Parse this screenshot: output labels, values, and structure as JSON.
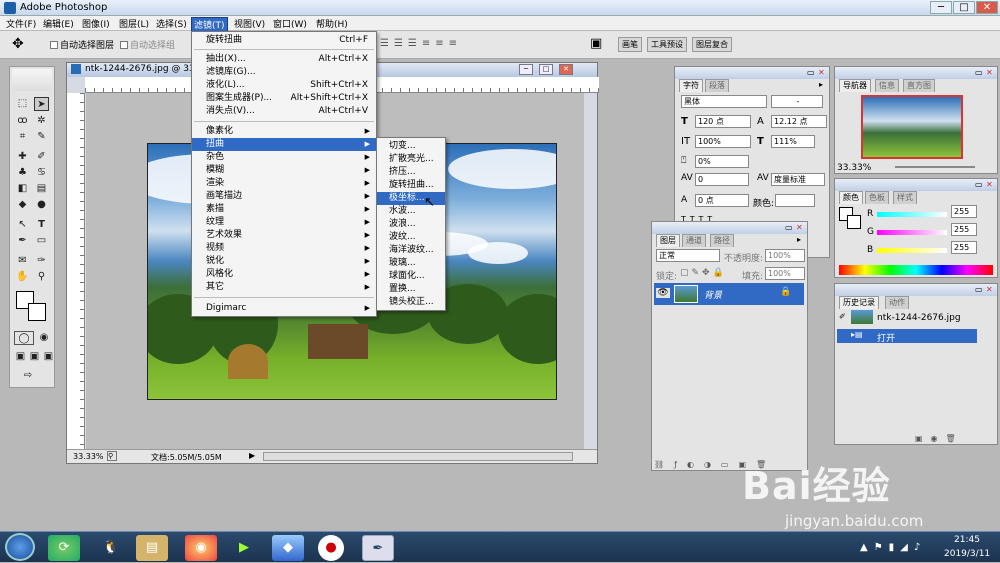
{
  "app": {
    "title": "Adobe Photoshop"
  },
  "menubar": [
    "文件(F)",
    "编辑(E)",
    "图像(I)",
    "图层(L)",
    "选择(S)",
    "滤镜(T)",
    "视图(V)",
    "窗口(W)",
    "帮助(H)"
  ],
  "options": {
    "auto_select_layer": "自动选择图层",
    "auto_select_group": "自动选择组",
    "dock_tabs": [
      "画笔",
      "工具预设",
      "图层复合"
    ]
  },
  "document": {
    "title": "ntk-1244-2676.jpg @ 33",
    "zoom": "33.33%",
    "doc_info": "文档:5.05M/5.05M"
  },
  "filter_menu": {
    "items": [
      {
        "label": "旋转扭曲",
        "shortcut": "Ctrl+F"
      },
      {
        "label": "抽出(X)...",
        "shortcut": "Alt+Ctrl+X"
      },
      {
        "label": "滤镜库(G)...",
        "shortcut": ""
      },
      {
        "label": "液化(L)...",
        "shortcut": "Shift+Ctrl+X"
      },
      {
        "label": "图案生成器(P)...",
        "shortcut": "Alt+Shift+Ctrl+X"
      },
      {
        "label": "消失点(V)...",
        "shortcut": "Alt+Ctrl+V"
      },
      {
        "label": "像素化",
        "submenu": true
      },
      {
        "label": "扭曲",
        "submenu": true,
        "highlight": true
      },
      {
        "label": "杂色",
        "submenu": true
      },
      {
        "label": "模糊",
        "submenu": true
      },
      {
        "label": "渲染",
        "submenu": true
      },
      {
        "label": "画笔描边",
        "submenu": true
      },
      {
        "label": "素描",
        "submenu": true
      },
      {
        "label": "纹理",
        "submenu": true
      },
      {
        "label": "艺术效果",
        "submenu": true
      },
      {
        "label": "视频",
        "submenu": true
      },
      {
        "label": "锐化",
        "submenu": true
      },
      {
        "label": "风格化",
        "submenu": true
      },
      {
        "label": "其它",
        "submenu": true
      },
      {
        "label": "Digimarc",
        "submenu": true
      }
    ]
  },
  "distort_submenu": [
    "切变...",
    "扩散亮光...",
    "挤压...",
    "旋转扭曲...",
    "极坐标...",
    "水波...",
    "波浪...",
    "波纹...",
    "海洋波纹...",
    "玻璃...",
    "球面化...",
    "置换...",
    "镜头校正..."
  ],
  "char_panel": {
    "tabs": [
      "字符",
      "段落"
    ],
    "font": "黑体",
    "style": "-",
    "size": "120 点",
    "leading": "12.12 点",
    "vscale": "100%",
    "hscale": "111%",
    "tracking": "0%",
    "kerning": "0",
    "kerning_type": "度量标准",
    "baseline": "0 点",
    "color_label": "颜色:"
  },
  "navigator": {
    "tabs": [
      "导航器",
      "信息",
      "直方图"
    ],
    "zoom": "33.33%"
  },
  "color_panel": {
    "tabs": [
      "颜色",
      "色板",
      "样式"
    ],
    "r_label": "R",
    "g_label": "G",
    "b_label": "B",
    "r": "255",
    "g": "255",
    "b": "255"
  },
  "layers_panel": {
    "tabs": [
      "图层",
      "通道",
      "路径"
    ],
    "mode": "正常",
    "opacity_label": "不透明度:",
    "opacity": "100%",
    "lock_label": "锁定:",
    "fill_label": "填充:",
    "fill": "100%",
    "layer_name": "背景"
  },
  "history_panel": {
    "tabs": [
      "历史记录",
      "动作"
    ],
    "snapshot": "ntk-1244-2676.jpg",
    "state": "打开"
  },
  "taskbar": {
    "time": "21:45",
    "date": "2019/3/11"
  },
  "watermark": {
    "brand": "Bai经验",
    "url": "jingyan.baidu.com"
  },
  "colors": {
    "highlight": "#316ac5",
    "taskbar": "#1c3350"
  }
}
